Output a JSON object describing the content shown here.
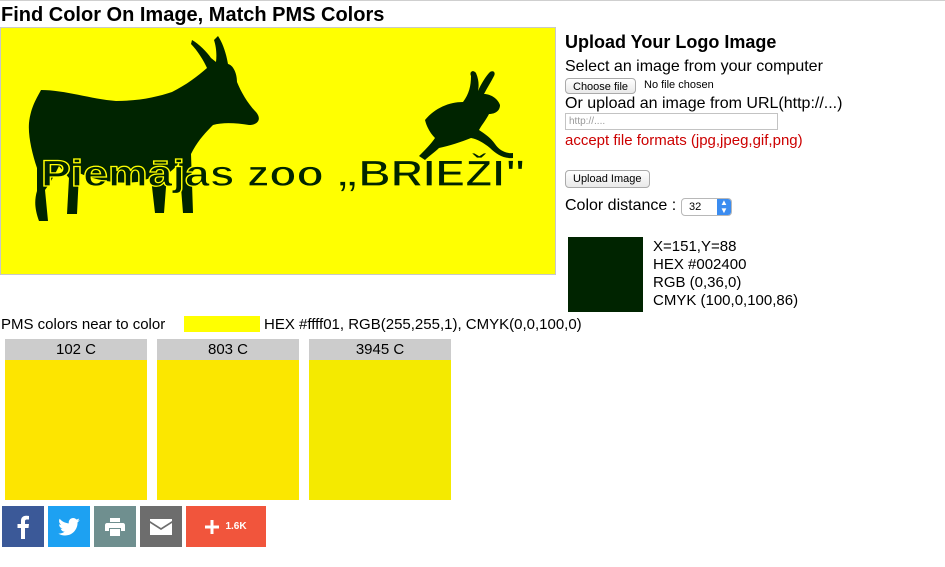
{
  "page": {
    "title": "Find Color On Image, Match PMS Colors"
  },
  "logo": {
    "text": "Piemājas zoo „BRIEŽI\"",
    "background": "#ffff01",
    "figure_color": "#002400"
  },
  "upload": {
    "heading": "Upload Your Logo Image",
    "select_text": "Select an image from your computer",
    "choose_button": "Choose file",
    "no_file": "No file chosen",
    "url_text": "Or upload an image from URL(http://...)",
    "url_placeholder": "http://....",
    "formats": "accept file formats (jpg,jpeg,gif,png)",
    "upload_button": "Upload Image",
    "distance_label": "Color distance :",
    "distance_value": "32"
  },
  "picked": {
    "color": "#002400",
    "coords": "X=151,Y=88",
    "hex": "HEX #002400",
    "rgb": "RGB (0,36,0)",
    "cmyk": "CMYK (100,0,100,86)"
  },
  "near": {
    "label": "PMS colors near to color",
    "swatch_color": "#ffff01",
    "values": "HEX #ffff01, RGB(255,255,1), CMYK(0,0,100,0)"
  },
  "pms": [
    {
      "name": "102 C",
      "color": "#fde500"
    },
    {
      "name": "803 C",
      "color": "#fbe700"
    },
    {
      "name": "3945 C",
      "color": "#f4ea00"
    }
  ],
  "share": {
    "facebook": {
      "icon": "facebook-icon",
      "color": "#3b5998"
    },
    "twitter": {
      "icon": "twitter-icon",
      "color": "#1da1f2"
    },
    "print": {
      "icon": "print-icon",
      "color": "#6f8f8f"
    },
    "email": {
      "icon": "email-icon",
      "color": "#6d6d6d"
    },
    "more": {
      "icon": "plus-icon",
      "color": "#f1553c",
      "count": "1.6K"
    }
  }
}
